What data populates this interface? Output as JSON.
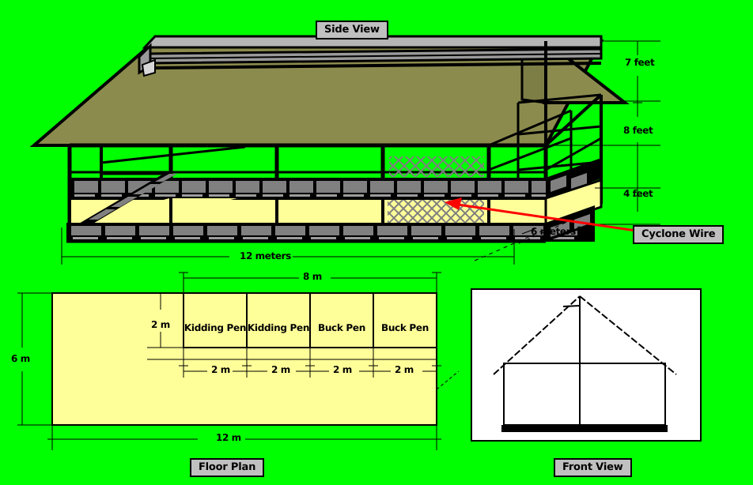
{
  "figure": {
    "background_color": "#00ff00",
    "roof_color": "#8b8b4e",
    "roof_ridge_color": "#a0a0a0",
    "wall_slat_color": "#808080",
    "floor_color": "#ffff99",
    "outline_color": "#000000",
    "pointer_color": "#ff0000"
  },
  "captions": {
    "side_view": "Side View",
    "floor_plan": "Floor Plan",
    "front_view": "Front View"
  },
  "side_view": {
    "height_dimensions": [
      {
        "label": "7 feet"
      },
      {
        "label": "8 feet"
      },
      {
        "label": "4 feet"
      }
    ],
    "width_dimension": "12 meters",
    "depth_dimension": "6 meters",
    "callout": "Cyclone Wire"
  },
  "floor_plan": {
    "overall_width": "12 m",
    "overall_height": "6 m",
    "pen_block_width": "8 m",
    "pen_depth": "2 m",
    "pen_widths": [
      "2 m",
      "2 m",
      "2 m",
      "2 m"
    ],
    "pens": [
      {
        "label": "Kidding Pen"
      },
      {
        "label": "Kidding Pen"
      },
      {
        "label": "Buck Pen"
      },
      {
        "label": "Buck Pen"
      }
    ]
  },
  "front_view": {
    "panel_background": "#ffffff"
  }
}
